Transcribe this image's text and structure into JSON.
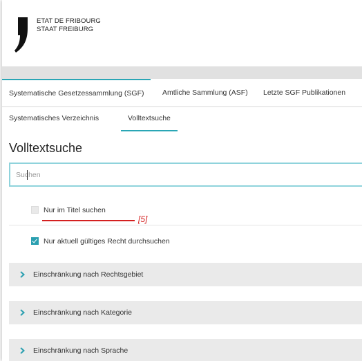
{
  "header": {
    "logo_line1": "ETAT DE FRIBOURG",
    "logo_line2": "STAAT FREIBURG"
  },
  "tabs": [
    {
      "label": "Systematische Gesetzessammlung (SGF)",
      "active": true
    },
    {
      "label": "Amtliche Sammlung (ASF)",
      "active": false
    },
    {
      "label": "Letzte SGF Publikationen",
      "active": false
    }
  ],
  "subtabs": [
    {
      "label": "Systematisches Verzeichnis",
      "active": false
    },
    {
      "label": "Volltextsuche",
      "active": true
    }
  ],
  "page_title": "Volltextsuche",
  "search": {
    "placeholder": "Suchen",
    "value": ""
  },
  "options": [
    {
      "label": "Nur im Titel suchen",
      "checked": false
    },
    {
      "label": "Nur aktuell gültiges Recht durchsuchen",
      "checked": true
    }
  ],
  "annotation": {
    "label": "[5]",
    "color": "#d42020"
  },
  "accordions": [
    {
      "label": "Einschränkung nach Rechtsgebiet"
    },
    {
      "label": "Einschränkung nach Kategorie"
    },
    {
      "label": "Einschränkung nach Sprache"
    }
  ],
  "colors": {
    "accent": "#2aa6b5",
    "band": "#e1e1e1",
    "panel": "#eaeaea"
  }
}
